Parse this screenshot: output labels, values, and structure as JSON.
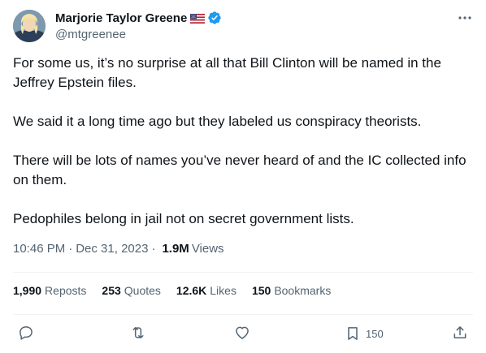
{
  "author": {
    "display_name": "Marjorie Taylor Greene",
    "handle": "@mtgreenee",
    "flag_icon": "us-flag-icon",
    "verified_icon": "verified-badge-icon",
    "verified_color": "#1d9bf0"
  },
  "tweet": {
    "paragraphs": [
      "For some us, it’s no surprise at all that Bill Clinton will be named in the Jeffrey Epstein files.",
      "We said it a long time ago but they labeled us conspiracy theorists.",
      "There will be lots of names you’ve never heard of and the IC collected info on them.",
      "Pedophiles belong in jail not on secret government lists."
    ],
    "time": "10:46 PM",
    "date": "Dec 31, 2023",
    "separator": "·",
    "views_count": "1.9M",
    "views_label": "Views"
  },
  "stats": {
    "reposts": {
      "count": "1,990",
      "label": "Reposts"
    },
    "quotes": {
      "count": "253",
      "label": "Quotes"
    },
    "likes": {
      "count": "12.6K",
      "label": "Likes"
    },
    "bookmarks": {
      "count": "150",
      "label": "Bookmarks"
    }
  },
  "actions": {
    "reply_icon": "reply-icon",
    "retweet_icon": "retweet-icon",
    "like_icon": "heart-icon",
    "bookmark_icon": "bookmark-icon",
    "bookmark_count": "150",
    "share_icon": "share-icon",
    "more_icon": "more-icon"
  },
  "colors": {
    "text_primary": "#0f1419",
    "text_secondary": "#536471",
    "divider": "#eff3f4",
    "accent": "#1d9bf0"
  }
}
